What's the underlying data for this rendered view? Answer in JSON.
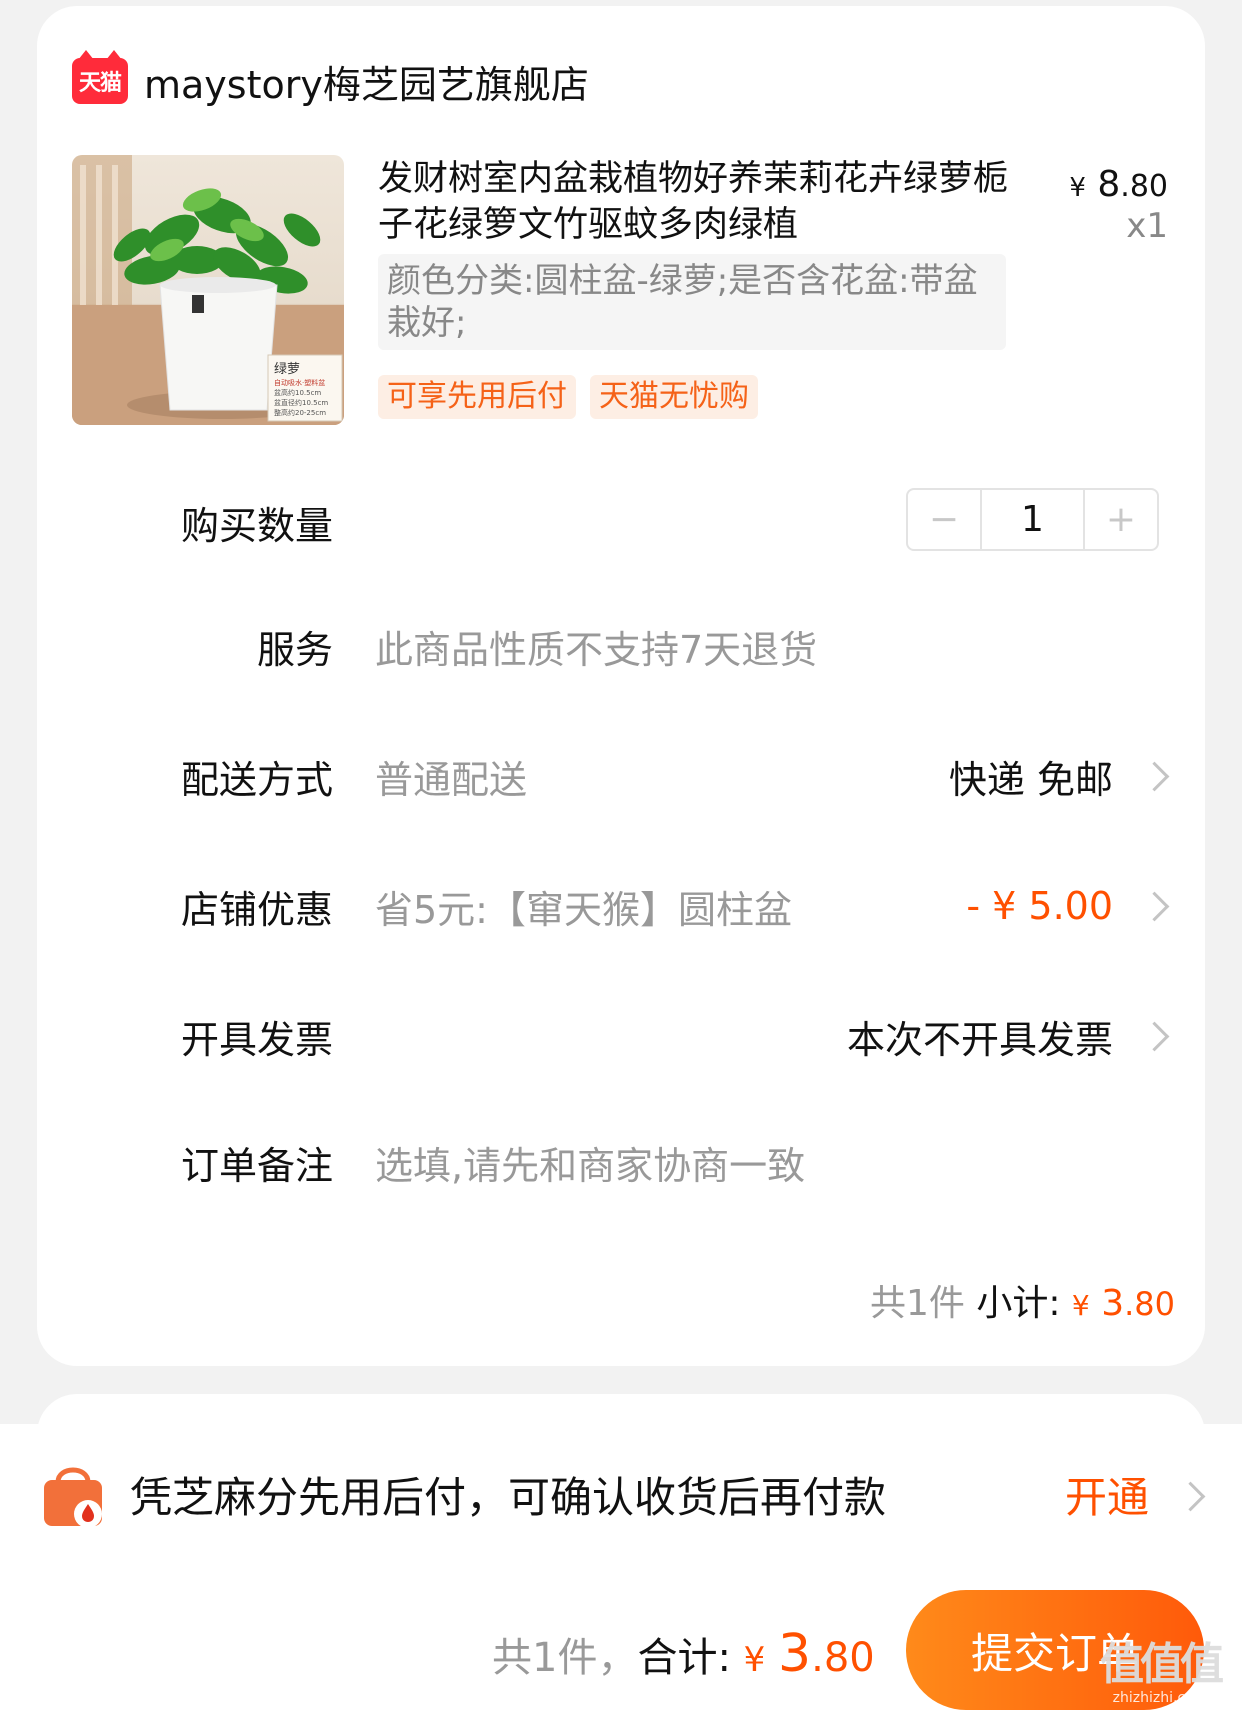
{
  "shop": {
    "badge": "天猫",
    "name": "maystory梅芝园艺旗舰店"
  },
  "product": {
    "title": "发财树室内盆栽植物好养茉莉花卉绿萝栀子花绿箩文竹驱蚊多肉绿植",
    "price_symbol": "¥",
    "price_int": "8",
    "price_dec": ".80",
    "quantity_label": "x1",
    "sku": "颜色分类:圆柱盆-绿萝;是否含花盆:带盆栽好;",
    "tags": [
      "可享先用后付",
      "天猫无忧购"
    ],
    "image_text": {
      "name": "绿萝",
      "line1": "自动吸水·塑料盆",
      "line2": "盆高约10.5cm",
      "line3": "盆直径约10.5cm",
      "line4": "整高约20-25cm"
    }
  },
  "rows": {
    "quantity": {
      "label": "购买数量",
      "value": "1",
      "minus": "−",
      "plus": "+"
    },
    "service": {
      "label": "服务",
      "value": "此商品性质不支持7天退货"
    },
    "delivery": {
      "label": "配送方式",
      "value": "普通配送",
      "right": "快递 免邮"
    },
    "discount": {
      "label": "店铺优惠",
      "value": "省5元:【窜天猴】圆柱盆",
      "right": "- ¥ 5.00"
    },
    "invoice": {
      "label": "开具发票",
      "right": "本次不开具发票"
    },
    "note": {
      "label": "订单备注",
      "placeholder": "选填,请先和商家协商一致"
    }
  },
  "subtotal": {
    "count": "共1件",
    "label": "小计:",
    "symbol": "¥",
    "int": "3",
    "dec": ".80"
  },
  "zhima": {
    "text": "凭芝麻分先用后付，可确认收货后再付款",
    "action": "开通"
  },
  "footer": {
    "count": "共1件，",
    "label": "合计:",
    "symbol": "¥",
    "int": "3",
    "dec": ".80",
    "submit": "提交订单"
  },
  "watermark": {
    "glyphs": "值值值",
    "domain": "zhizhizhi.com"
  },
  "colors": {
    "accent": "#ff5000",
    "tmall_red": "#ff2b3a",
    "tag_bg": "#fdeee4"
  }
}
